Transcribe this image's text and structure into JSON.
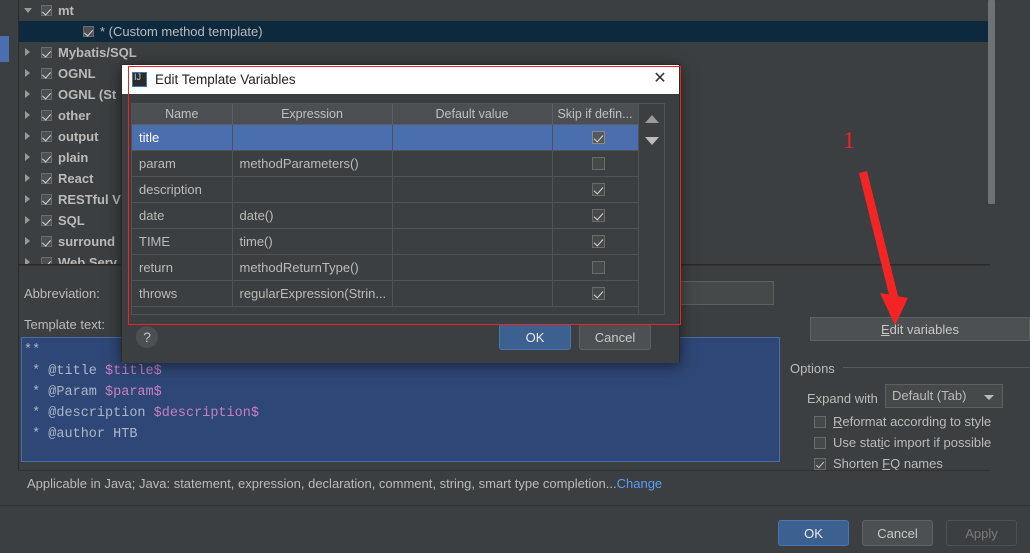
{
  "tree": {
    "items": [
      {
        "label": "mt",
        "checked": true,
        "expanded": true,
        "twisty": "open",
        "child": false,
        "selected": false
      },
      {
        "label": "* (Custom method template)",
        "checked": true,
        "twisty": "none",
        "child": true,
        "selected": true
      },
      {
        "label": "Mybatis/SQL",
        "checked": true,
        "twisty": "closed",
        "child": false,
        "selected": false
      },
      {
        "label": "OGNL",
        "checked": true,
        "twisty": "closed",
        "child": false,
        "selected": false
      },
      {
        "label": "OGNL (St",
        "checked": true,
        "twisty": "closed",
        "child": false,
        "selected": false
      },
      {
        "label": "other",
        "checked": true,
        "twisty": "closed",
        "child": false,
        "selected": false
      },
      {
        "label": "output",
        "checked": true,
        "twisty": "closed",
        "child": false,
        "selected": false
      },
      {
        "label": "plain",
        "checked": true,
        "twisty": "closed",
        "child": false,
        "selected": false
      },
      {
        "label": "React",
        "checked": true,
        "twisty": "closed",
        "child": false,
        "selected": false
      },
      {
        "label": "RESTful V",
        "checked": true,
        "twisty": "closed",
        "child": false,
        "selected": false
      },
      {
        "label": "SQL",
        "checked": true,
        "twisty": "closed",
        "child": false,
        "selected": false
      },
      {
        "label": "surround",
        "checked": true,
        "twisty": "closed",
        "child": false,
        "selected": false
      },
      {
        "label": "Web Serv",
        "checked": true,
        "twisty": "closed",
        "child": false,
        "selected": false
      }
    ]
  },
  "detail": {
    "abbreviation_label": "Abbreviation:",
    "abbreviation_value": "",
    "template_text_label": "Template text:",
    "template_lines": [
      "**",
      " * @title $title$",
      " * @Param $param$",
      " * @description $description$",
      " * @author HTB"
    ],
    "edit_variables_button": "Edit variables",
    "options_header": "Options",
    "expand_with_label": "Expand with",
    "expand_with_value": "Default (Tab)",
    "checkboxes": [
      {
        "label": "Reformat according to style",
        "checked": false
      },
      {
        "label": "Use static import if possible",
        "checked": false
      },
      {
        "label": "Shorten FQ names",
        "checked": true
      }
    ]
  },
  "applicable": {
    "text": "Applicable in Java; Java: statement, expression, declaration, comment, string, smart type completion...",
    "change_link": "Change"
  },
  "footer": {
    "ok": "OK",
    "cancel": "Cancel",
    "apply": "Apply"
  },
  "dialog": {
    "title": "Edit Template Variables",
    "close_icon": "✕",
    "help_icon": "?",
    "ok": "OK",
    "cancel": "Cancel",
    "columns": [
      "Name",
      "Expression",
      "Default value",
      "Skip if defin..."
    ],
    "rows": [
      {
        "name": "title",
        "expression": "",
        "default": "",
        "skip": true,
        "selected": true
      },
      {
        "name": "param",
        "expression": "methodParameters()",
        "default": "",
        "skip": false,
        "selected": false
      },
      {
        "name": "description",
        "expression": "",
        "default": "",
        "skip": true,
        "selected": false
      },
      {
        "name": "date",
        "expression": "date()",
        "default": "",
        "skip": true,
        "selected": false
      },
      {
        "name": "TIME",
        "expression": "time()",
        "default": "",
        "skip": true,
        "selected": false
      },
      {
        "name": "return",
        "expression": "methodReturnType()",
        "default": "",
        "skip": false,
        "selected": false
      },
      {
        "name": "throws",
        "expression": "regularExpression(Strin...",
        "default": "",
        "skip": true,
        "selected": false
      }
    ]
  },
  "annotation": {
    "number": "1",
    "color": "#ee2222"
  },
  "colors": {
    "background": "#3c3f41",
    "selection": "#4b6eaf",
    "tree_selection": "#0d293e",
    "template_bg": "#2f4776",
    "link": "#589df6",
    "primary_button": "#3c608f"
  }
}
